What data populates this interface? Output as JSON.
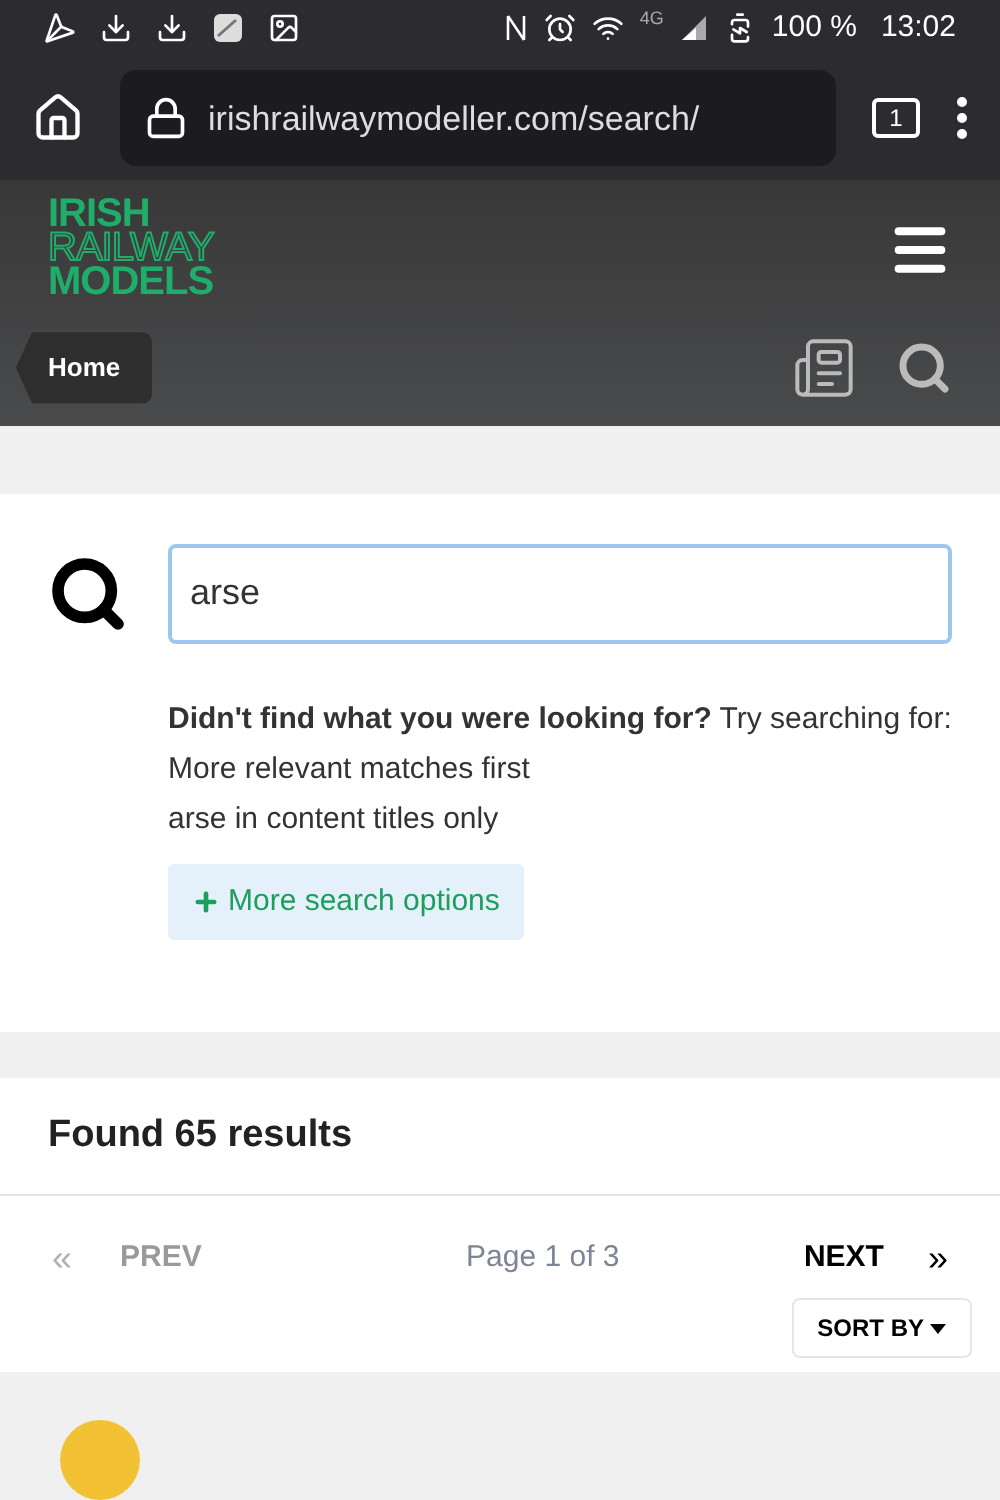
{
  "status_bar": {
    "network": "4G",
    "battery": "100 %",
    "time": "13:02"
  },
  "browser": {
    "url": "irishrailwaymodeller.com/search/",
    "tab_count": "1"
  },
  "site_header": {
    "logo": [
      "IRISH",
      "RAILWAY",
      "MODELS"
    ],
    "breadcrumb": "Home"
  },
  "search": {
    "value": "arse",
    "suggestion": "**Didn't find what you were looking for?** Try searching for:",
    "links": [
      "More relevant matches first",
      "arse in content titles only"
    ],
    "options_button": "More search options"
  },
  "results": {
    "title": "Found 65 results",
    "pagination": {
      "first": "«",
      "prev": "PREV",
      "prev_disabled": true,
      "page": "Page 1 of 3",
      "next": "NEXT",
      "next_disabled": false,
      "last": "»"
    },
    "sort_button": "SORT BY"
  }
}
